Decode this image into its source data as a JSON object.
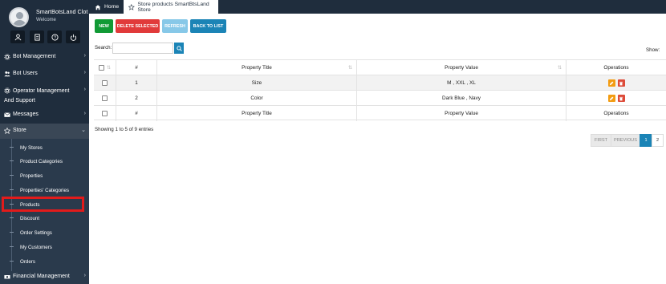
{
  "sidebar": {
    "profile": {
      "name": "SmartBotsLand Clot",
      "welcome": "Welcome"
    },
    "icons": [
      "user-icon",
      "document-icon",
      "help-icon",
      "power-icon"
    ],
    "menu": [
      {
        "label": "Bot Management",
        "icon": "gear-icon"
      },
      {
        "label": "Bot Users",
        "icon": "users-icon"
      },
      {
        "label": "Operator Management And Support",
        "icon": "gear-icon"
      },
      {
        "label": "Messages",
        "icon": "envelope-icon"
      },
      {
        "label": "Store",
        "icon": "star-icon"
      },
      {
        "label": "Financial Management",
        "icon": "money-icon"
      }
    ],
    "submenu": [
      {
        "label": "My Stores"
      },
      {
        "label": "Product Categories"
      },
      {
        "label": "Properties"
      },
      {
        "label": "Properties' Categories"
      },
      {
        "label": "Products"
      },
      {
        "label": "Discount"
      },
      {
        "label": "Order Settings"
      },
      {
        "label": "My Customers"
      },
      {
        "label": "Orders"
      }
    ]
  },
  "tabs": {
    "home": "Home",
    "active": "Store products SmartBtsLand Store"
  },
  "toolbar": {
    "new": "NEW",
    "delete_selected": "DELETE SELECTED",
    "refresh": "REFRESH",
    "back": "BACK TO LIST"
  },
  "search": {
    "label": "Search:",
    "value": ""
  },
  "show_label": "Show:",
  "table": {
    "headers": {
      "num": "#",
      "title": "Property Title",
      "value": "Property Value",
      "ops": "Operations"
    },
    "rows": [
      {
        "num": "1",
        "title": "Size",
        "value": "M , XXL , XL"
      },
      {
        "num": "2",
        "title": "Color",
        "value": "Dark Blue , Navy"
      }
    ]
  },
  "info": "Showing 1 to 5 of 9 entries",
  "pager": {
    "first": "FIRST",
    "prev": "PREVIOUS",
    "p1": "1",
    "p2": "2"
  },
  "colors": {
    "sidebar": "#1f2d3d",
    "new": "#119a35",
    "delete": "#e13a3a",
    "refresh": "#87c8e8",
    "back": "#1b84b6",
    "highlight": "#e21b1b"
  }
}
